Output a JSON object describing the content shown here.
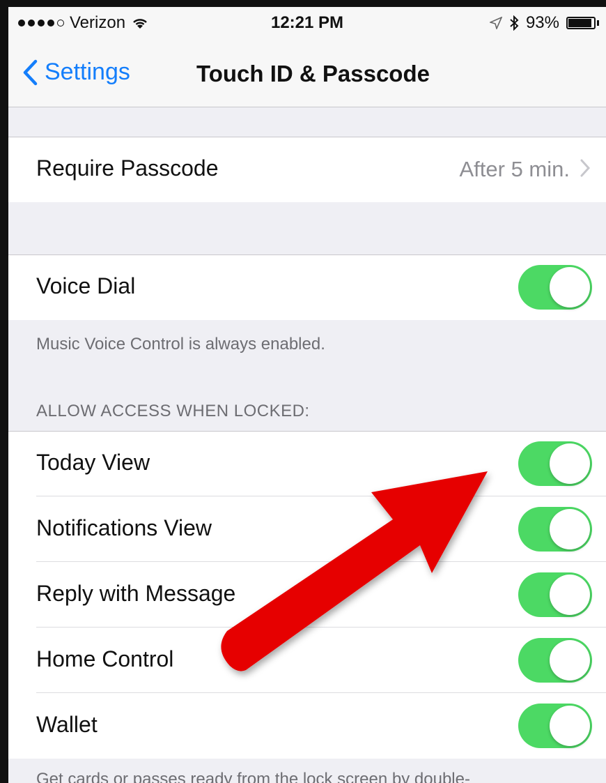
{
  "status_bar": {
    "carrier": "Verizon",
    "time": "12:21 PM",
    "battery_percent": "93%",
    "battery_level": 0.93
  },
  "nav": {
    "back_label": "Settings",
    "title": "Touch ID & Passcode"
  },
  "require_passcode": {
    "label": "Require Passcode",
    "value": "After 5 min."
  },
  "voice_dial": {
    "label": "Voice Dial",
    "enabled": true,
    "footer": "Music Voice Control is always enabled."
  },
  "allow_access": {
    "header": "ALLOW ACCESS WHEN LOCKED:",
    "items": [
      {
        "label": "Today View",
        "enabled": true
      },
      {
        "label": "Notifications View",
        "enabled": true
      },
      {
        "label": "Reply with Message",
        "enabled": true
      },
      {
        "label": "Home Control",
        "enabled": true
      },
      {
        "label": "Wallet",
        "enabled": true
      }
    ],
    "footer": "Get cards or passes ready from the lock screen by double-"
  },
  "colors": {
    "toggle_on": "#4cd964",
    "link_blue": "#147efb",
    "arrow_red": "#e60000"
  },
  "icons": [
    "wifi-icon",
    "location-icon",
    "bluetooth-icon",
    "battery-icon",
    "back-chevron-icon",
    "chevron-right-icon",
    "arrow-annotation"
  ]
}
